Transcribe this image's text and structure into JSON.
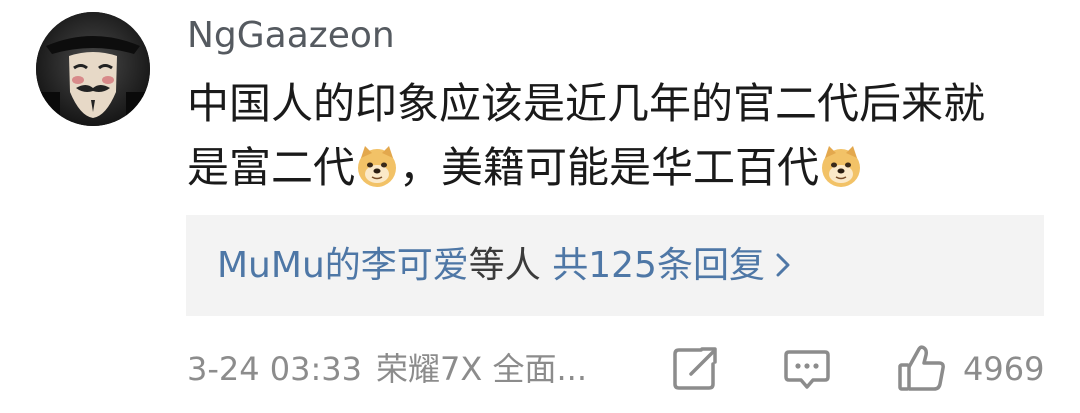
{
  "comment": {
    "username": "NgGaazeon",
    "text_line1": "中国人的印象应该是近几年的官二代后来就",
    "text_line2_part1": "是富二代",
    "text_line2_part2": "，美籍可能是华工百代",
    "emoji_icon": "doge-emoji-icon"
  },
  "replies": {
    "users": "MuMu的李可爱",
    "suffix": "等人",
    "count_text": "共125条回复",
    "chevron_icon": "chevron-right-icon"
  },
  "meta": {
    "timestamp": "3-24 03:33",
    "device": "荣耀7X 全面...",
    "like_count": "4969"
  },
  "colors": {
    "link": "#4e77a6",
    "meta": "#8c8c8c",
    "reply_bg": "#f3f3f3"
  }
}
